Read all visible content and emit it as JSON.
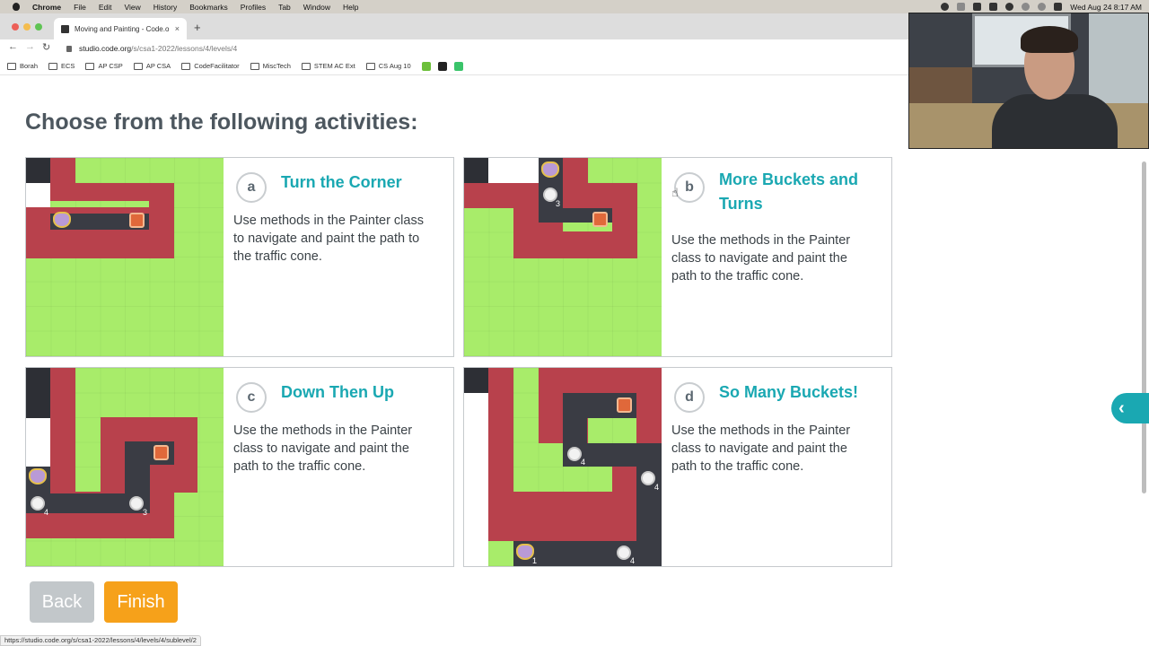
{
  "menubar": {
    "items": [
      "Chrome",
      "File",
      "Edit",
      "View",
      "History",
      "Bookmarks",
      "Profiles",
      "Tab",
      "Window",
      "Help"
    ],
    "clock": "Wed Aug 24  8:17 AM"
  },
  "browser": {
    "tab_title": "Moving and Painting - Code.o",
    "tab_close": "×",
    "new_tab": "+",
    "url_host": "studio.code.org",
    "url_path": "/s/csa1-2022/lessons/4/levels/4",
    "back": "←",
    "forward": "→",
    "reload": "↻"
  },
  "bookmarks": [
    "Borah",
    "ECS",
    "AP CSP",
    "AP CSA",
    "CodeFacilitator",
    "MiscTech",
    "STEM AC Ext",
    "CS Aug 10"
  ],
  "page": {
    "title": "Choose from the following activities:",
    "activities": [
      {
        "letter": "a",
        "title_lines": [
          "Turn the Corner"
        ],
        "desc_lines": [
          "Use methods in the Painter class",
          "to navigate and paint the path to",
          "the traffic cone."
        ]
      },
      {
        "letter": "b",
        "title_lines": [
          "More Buckets and",
          "Turns"
        ],
        "desc_lines": [
          "Use the methods in the Painter",
          "class to navigate and paint the",
          "path to the traffic cone."
        ]
      },
      {
        "letter": "c",
        "title_lines": [
          "Down Then Up"
        ],
        "desc_lines": [
          "Use the methods in the Painter",
          "class to navigate and paint the",
          "path to the traffic cone."
        ]
      },
      {
        "letter": "d",
        "title_lines": [
          "So Many Buckets!"
        ],
        "desc_lines": [
          "Use the methods in the Painter",
          "class to navigate and paint the",
          "path to the traffic cone."
        ]
      }
    ],
    "bucket_counts": {
      "b": [
        "3"
      ],
      "c": [
        "4",
        "3"
      ],
      "d": [
        "4",
        "4",
        "4",
        "1"
      ]
    },
    "back_label": "Back",
    "finish_label": "Finish",
    "side_tab": "‹"
  },
  "status_url": "https://studio.code.org/s/csa1-2022/lessons/4/levels/4/sublevel/2",
  "colors": {
    "accent": "#1aa8b2",
    "finish": "#f6a11a",
    "back": "#c2c7ca",
    "grass": "#a8ec6a",
    "path_border": "#b8414c"
  }
}
